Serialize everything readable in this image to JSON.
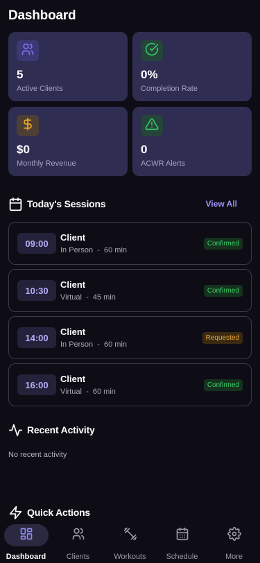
{
  "header": {
    "title": "Dashboard"
  },
  "stats": [
    {
      "icon": "users-icon",
      "value": "5",
      "label": "Active Clients",
      "icon_color": "#7c74f0",
      "icon_bg": "#3b3874"
    },
    {
      "icon": "check-circle-icon",
      "value": "0%",
      "label": "Completion Rate",
      "icon_color": "#33c665",
      "icon_bg": "#25453b"
    },
    {
      "icon": "dollar-icon",
      "value": "$0",
      "label": "Monthly Revenue",
      "icon_color": "#f0a928",
      "icon_bg": "#4e3f35"
    },
    {
      "icon": "alert-triangle-icon",
      "value": "0",
      "label": "ACWR Alerts",
      "icon_color": "#33c665",
      "icon_bg": "#25453b"
    }
  ],
  "sessions_section": {
    "title": "Today's Sessions",
    "view_all_label": "View All",
    "items": [
      {
        "time": "09:00",
        "client": "Client",
        "mode": "In Person",
        "duration": "60 min",
        "status": "Confirmed"
      },
      {
        "time": "10:30",
        "client": "Client",
        "mode": "Virtual",
        "duration": "45 min",
        "status": "Confirmed"
      },
      {
        "time": "14:00",
        "client": "Client",
        "mode": "In Person",
        "duration": "60 min",
        "status": "Requested"
      },
      {
        "time": "16:00",
        "client": "Client",
        "mode": "Virtual",
        "duration": "60 min",
        "status": "Confirmed"
      }
    ]
  },
  "activity_section": {
    "title": "Recent Activity",
    "empty_text": "No recent activity"
  },
  "quick_actions_section": {
    "title": "Quick Actions"
  },
  "bottom_nav": [
    {
      "label": "Dashboard",
      "icon": "grid-icon",
      "active": true
    },
    {
      "label": "Clients",
      "icon": "users-icon",
      "active": false
    },
    {
      "label": "Workouts",
      "icon": "dumbbell-icon",
      "active": false
    },
    {
      "label": "Schedule",
      "icon": "calendar-icon",
      "active": false
    },
    {
      "label": "More",
      "icon": "gear-icon",
      "active": false
    }
  ],
  "colors": {
    "background": "#0e0d15",
    "card": "#2f2d52",
    "accent": "#9b95f5",
    "confirmed": "#3fcf6a",
    "requested": "#e8a73c"
  }
}
